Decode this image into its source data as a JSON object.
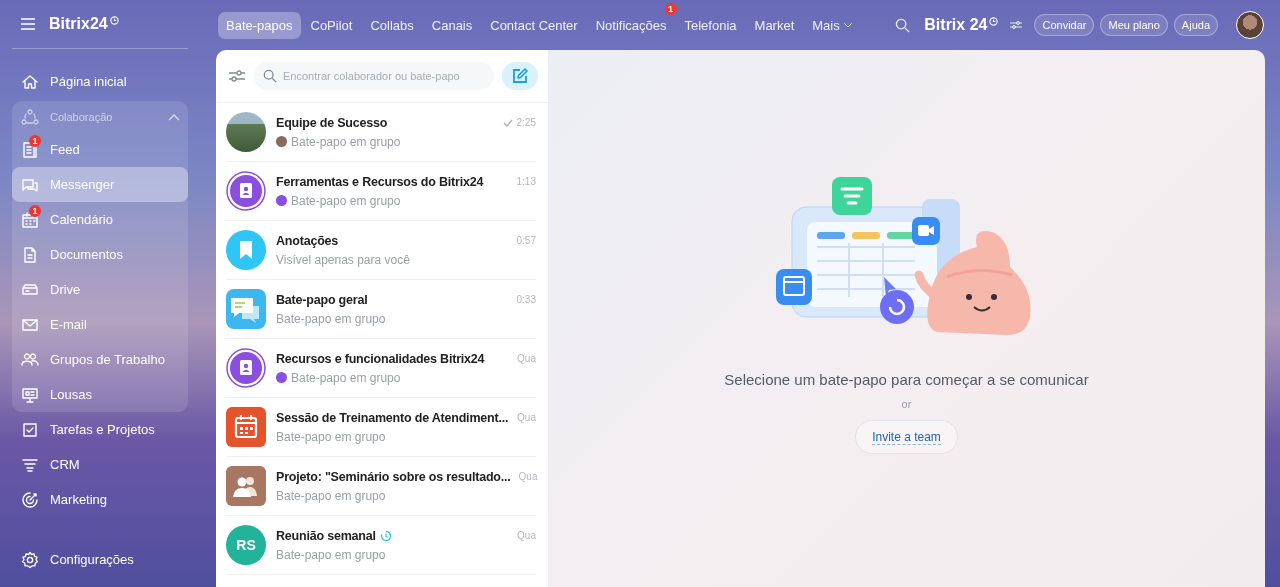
{
  "sidebar": {
    "logo": "Bitrix24",
    "items": [
      {
        "kind": "item",
        "label": "Página inicial",
        "selected": false
      },
      {
        "kind": "group",
        "label": "Colaboração",
        "expanded": true,
        "children": [
          {
            "label": "Feed",
            "badge": "1",
            "selected": false
          },
          {
            "label": "Messenger",
            "selected": true
          },
          {
            "label": "Calendário",
            "badge": "1",
            "selected": false
          },
          {
            "label": "Documentos",
            "selected": false
          },
          {
            "label": "Drive",
            "selected": false
          },
          {
            "label": "E-mail",
            "selected": false
          },
          {
            "label": "Grupos de Trabalho",
            "selected": false
          },
          {
            "label": "Lousas",
            "selected": false
          }
        ]
      },
      {
        "kind": "item",
        "label": "Tarefas e Projetos",
        "selected": false
      },
      {
        "kind": "item",
        "label": "CRM",
        "selected": false
      },
      {
        "kind": "item",
        "label": "Marketing",
        "selected": false
      }
    ],
    "settings": "Configurações"
  },
  "tabs": [
    {
      "label": "Bate-papos",
      "selected": true
    },
    {
      "label": "CoPilot",
      "selected": false
    },
    {
      "label": "Collabs",
      "selected": false
    },
    {
      "label": "Canais",
      "selected": false
    },
    {
      "label": "Contact Center",
      "selected": false
    },
    {
      "label": "Notificações",
      "selected": false,
      "badge": "1"
    },
    {
      "label": "Telefonia",
      "selected": false
    },
    {
      "label": "Market",
      "selected": false
    },
    {
      "label": "Mais",
      "selected": false,
      "menu": true
    }
  ],
  "header": {
    "logo": "Bitrix 24",
    "buttons": [
      "Convidar",
      "Meu plano",
      "Ajuda"
    ]
  },
  "chat_list": {
    "search": {
      "placeholder": "Encontrar colaborador ou bate-papo"
    },
    "chats": [
      {
        "title": "Equipe de Sucesso",
        "subtitle": "Bate-papo em grupo",
        "time": "2:25",
        "read": true,
        "timer": false,
        "sender_avatar": {
          "color": "#8a6a5c"
        },
        "avatar": {
          "kind": "photo"
        },
        "color": "#5d7a55"
      },
      {
        "title": "Ferramentas e Recursos do Bitrix24",
        "subtitle": "Bate-papo em grupo",
        "time": "1:13",
        "read": false,
        "timer": false,
        "sender_avatar": {
          "color": "#8b4fe0"
        },
        "avatar": {
          "kind": "bot"
        },
        "color": "#8b4fe0"
      },
      {
        "title": "Anotações",
        "subtitle": "Visível apenas para você",
        "time": "0:57",
        "read": false,
        "timer": false,
        "avatar": {
          "kind": "notes"
        },
        "color": "#2fc6f6"
      },
      {
        "title": "Bate-papo geral",
        "subtitle": "Bate-papo em grupo",
        "time": "0:33",
        "read": false,
        "timer": false,
        "avatar": {
          "kind": "chat"
        },
        "color": "#3bb8f0"
      },
      {
        "title": "Recursos e funcionalidades Bitrix24",
        "subtitle": "Bate-papo em grupo",
        "time": "Qua",
        "read": false,
        "timer": false,
        "sender_avatar": {
          "color": "#8b4fe0"
        },
        "avatar": {
          "kind": "bot"
        },
        "color": "#8b4fe0"
      },
      {
        "title": "Sessão de Treinamento de Atendiment...",
        "subtitle": "Bate-papo em grupo",
        "time": "Qua",
        "read": false,
        "timer": false,
        "avatar": {
          "kind": "calendar"
        },
        "color": "#e4532c"
      },
      {
        "title": "Projeto: \"Seminário sobre os resultado...",
        "subtitle": "Bate-papo em grupo",
        "time": "Qua",
        "read": false,
        "timer": false,
        "avatar": {
          "kind": "group"
        },
        "color": "#a87661"
      },
      {
        "title": "Reunião semanal",
        "subtitle": "Bate-papo em grupo",
        "time": "Qua",
        "read": false,
        "timer": true,
        "avatar": {
          "kind": "initials",
          "initials": "RS"
        },
        "color": "#22b39b"
      }
    ]
  },
  "empty_state": {
    "message": "Selecione um bate-papo para começar a se comunicar",
    "separator": "or",
    "button": "Invite a team"
  }
}
